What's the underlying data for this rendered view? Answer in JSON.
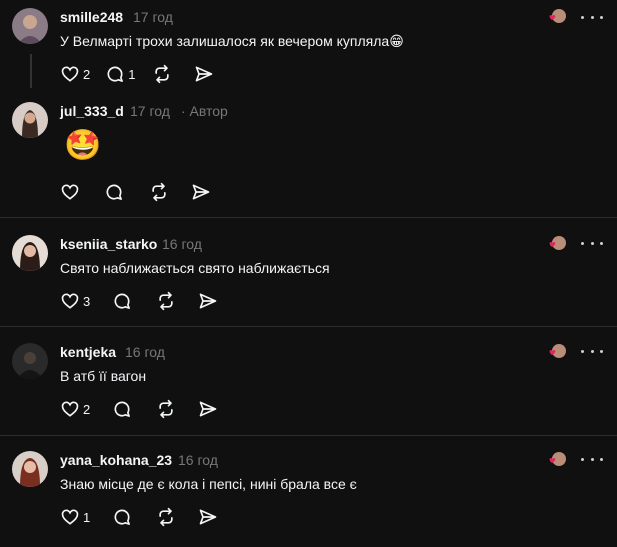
{
  "colors": {
    "background": "#101010",
    "text": "#f3f5f7",
    "muted": "#777777",
    "divider": "#2d2d2d",
    "like_red": "#e0245e"
  },
  "icons": {
    "like": "heart-icon",
    "reply": "comment-icon",
    "repost": "repost-icon",
    "share": "send-icon",
    "more": "more-icon"
  },
  "comments": [
    {
      "username": "smille248",
      "time": "17 год",
      "author_tag": "",
      "text": "У Велмарті трохи залишалося як вечером купляла",
      "emoji": "😁",
      "likes": "2",
      "replies": "1"
    },
    {
      "username": "jul_333_d",
      "time": "17 год",
      "author_tag": "· Автор",
      "text": "",
      "emoji": "🤩",
      "likes": "",
      "replies": ""
    },
    {
      "username": "kseniia_starko",
      "time": "16 год",
      "author_tag": "",
      "text": "Свято наближається свято наближається",
      "emoji": "",
      "likes": "3",
      "replies": ""
    },
    {
      "username": "kentjeka",
      "time": "16 год",
      "author_tag": "",
      "text": "В атб її вагон",
      "emoji": "",
      "likes": "2",
      "replies": ""
    },
    {
      "username": "yana_kohana_23",
      "time": "16 год",
      "author_tag": "",
      "text": "Знаю місце де є кола і пепсі, нині брала все є",
      "emoji": "",
      "likes": "1",
      "replies": ""
    }
  ]
}
